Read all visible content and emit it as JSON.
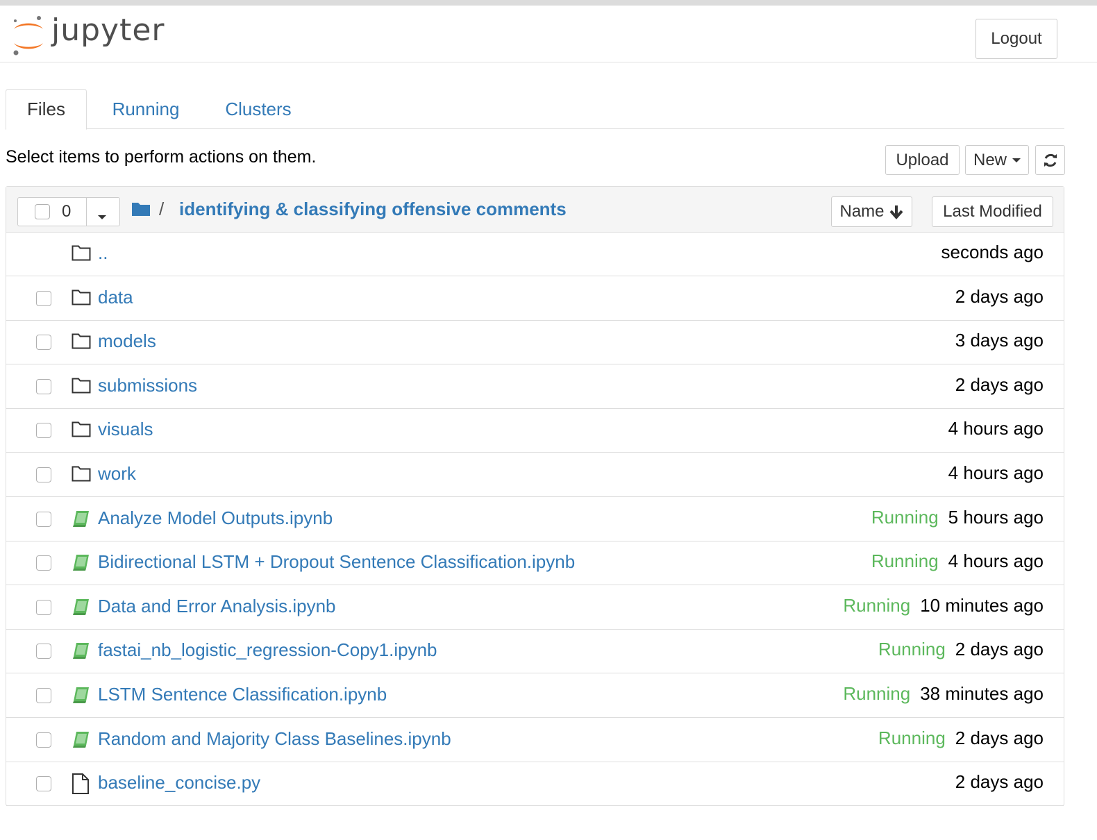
{
  "header": {
    "logo_text": "jupyter",
    "logout_label": "Logout"
  },
  "tabs": [
    {
      "label": "Files",
      "active": true
    },
    {
      "label": "Running",
      "active": false
    },
    {
      "label": "Clusters",
      "active": false
    }
  ],
  "toolbar": {
    "hint": "Select items to perform actions on them.",
    "upload_label": "Upload",
    "new_label": "New",
    "refresh_icon": "refresh-icon"
  },
  "list_header": {
    "selected_count": "0",
    "breadcrumb_separator": "/",
    "current_folder": "identifying & classifying offensive comments",
    "sort_name_label": "Name",
    "sort_modified_label": "Last Modified"
  },
  "items": [
    {
      "type": "parent",
      "name": "..",
      "status": "",
      "modified": "seconds ago"
    },
    {
      "type": "folder",
      "name": "data",
      "status": "",
      "modified": "2 days ago"
    },
    {
      "type": "folder",
      "name": "models",
      "status": "",
      "modified": "3 days ago"
    },
    {
      "type": "folder",
      "name": "submissions",
      "status": "",
      "modified": "2 days ago"
    },
    {
      "type": "folder",
      "name": "visuals",
      "status": "",
      "modified": "4 hours ago"
    },
    {
      "type": "folder",
      "name": "work",
      "status": "",
      "modified": "4 hours ago"
    },
    {
      "type": "notebook",
      "name": "Analyze Model Outputs.ipynb",
      "status": "Running",
      "modified": "5 hours ago"
    },
    {
      "type": "notebook",
      "name": "Bidirectional LSTM + Dropout Sentence Classification.ipynb",
      "status": "Running",
      "modified": "4 hours ago"
    },
    {
      "type": "notebook",
      "name": "Data and Error Analysis.ipynb",
      "status": "Running",
      "modified": "10 minutes ago"
    },
    {
      "type": "notebook",
      "name": "fastai_nb_logistic_regression-Copy1.ipynb",
      "status": "Running",
      "modified": "2 days ago"
    },
    {
      "type": "notebook",
      "name": "LSTM Sentence Classification.ipynb",
      "status": "Running",
      "modified": "38 minutes ago"
    },
    {
      "type": "notebook",
      "name": "Random and Majority Class Baselines.ipynb",
      "status": "Running",
      "modified": "2 days ago"
    },
    {
      "type": "file",
      "name": "baseline_concise.py",
      "status": "",
      "modified": "2 days ago"
    }
  ],
  "colors": {
    "link": "#337ab7",
    "running": "#5cb85c",
    "logo_orange": "#f37726"
  }
}
